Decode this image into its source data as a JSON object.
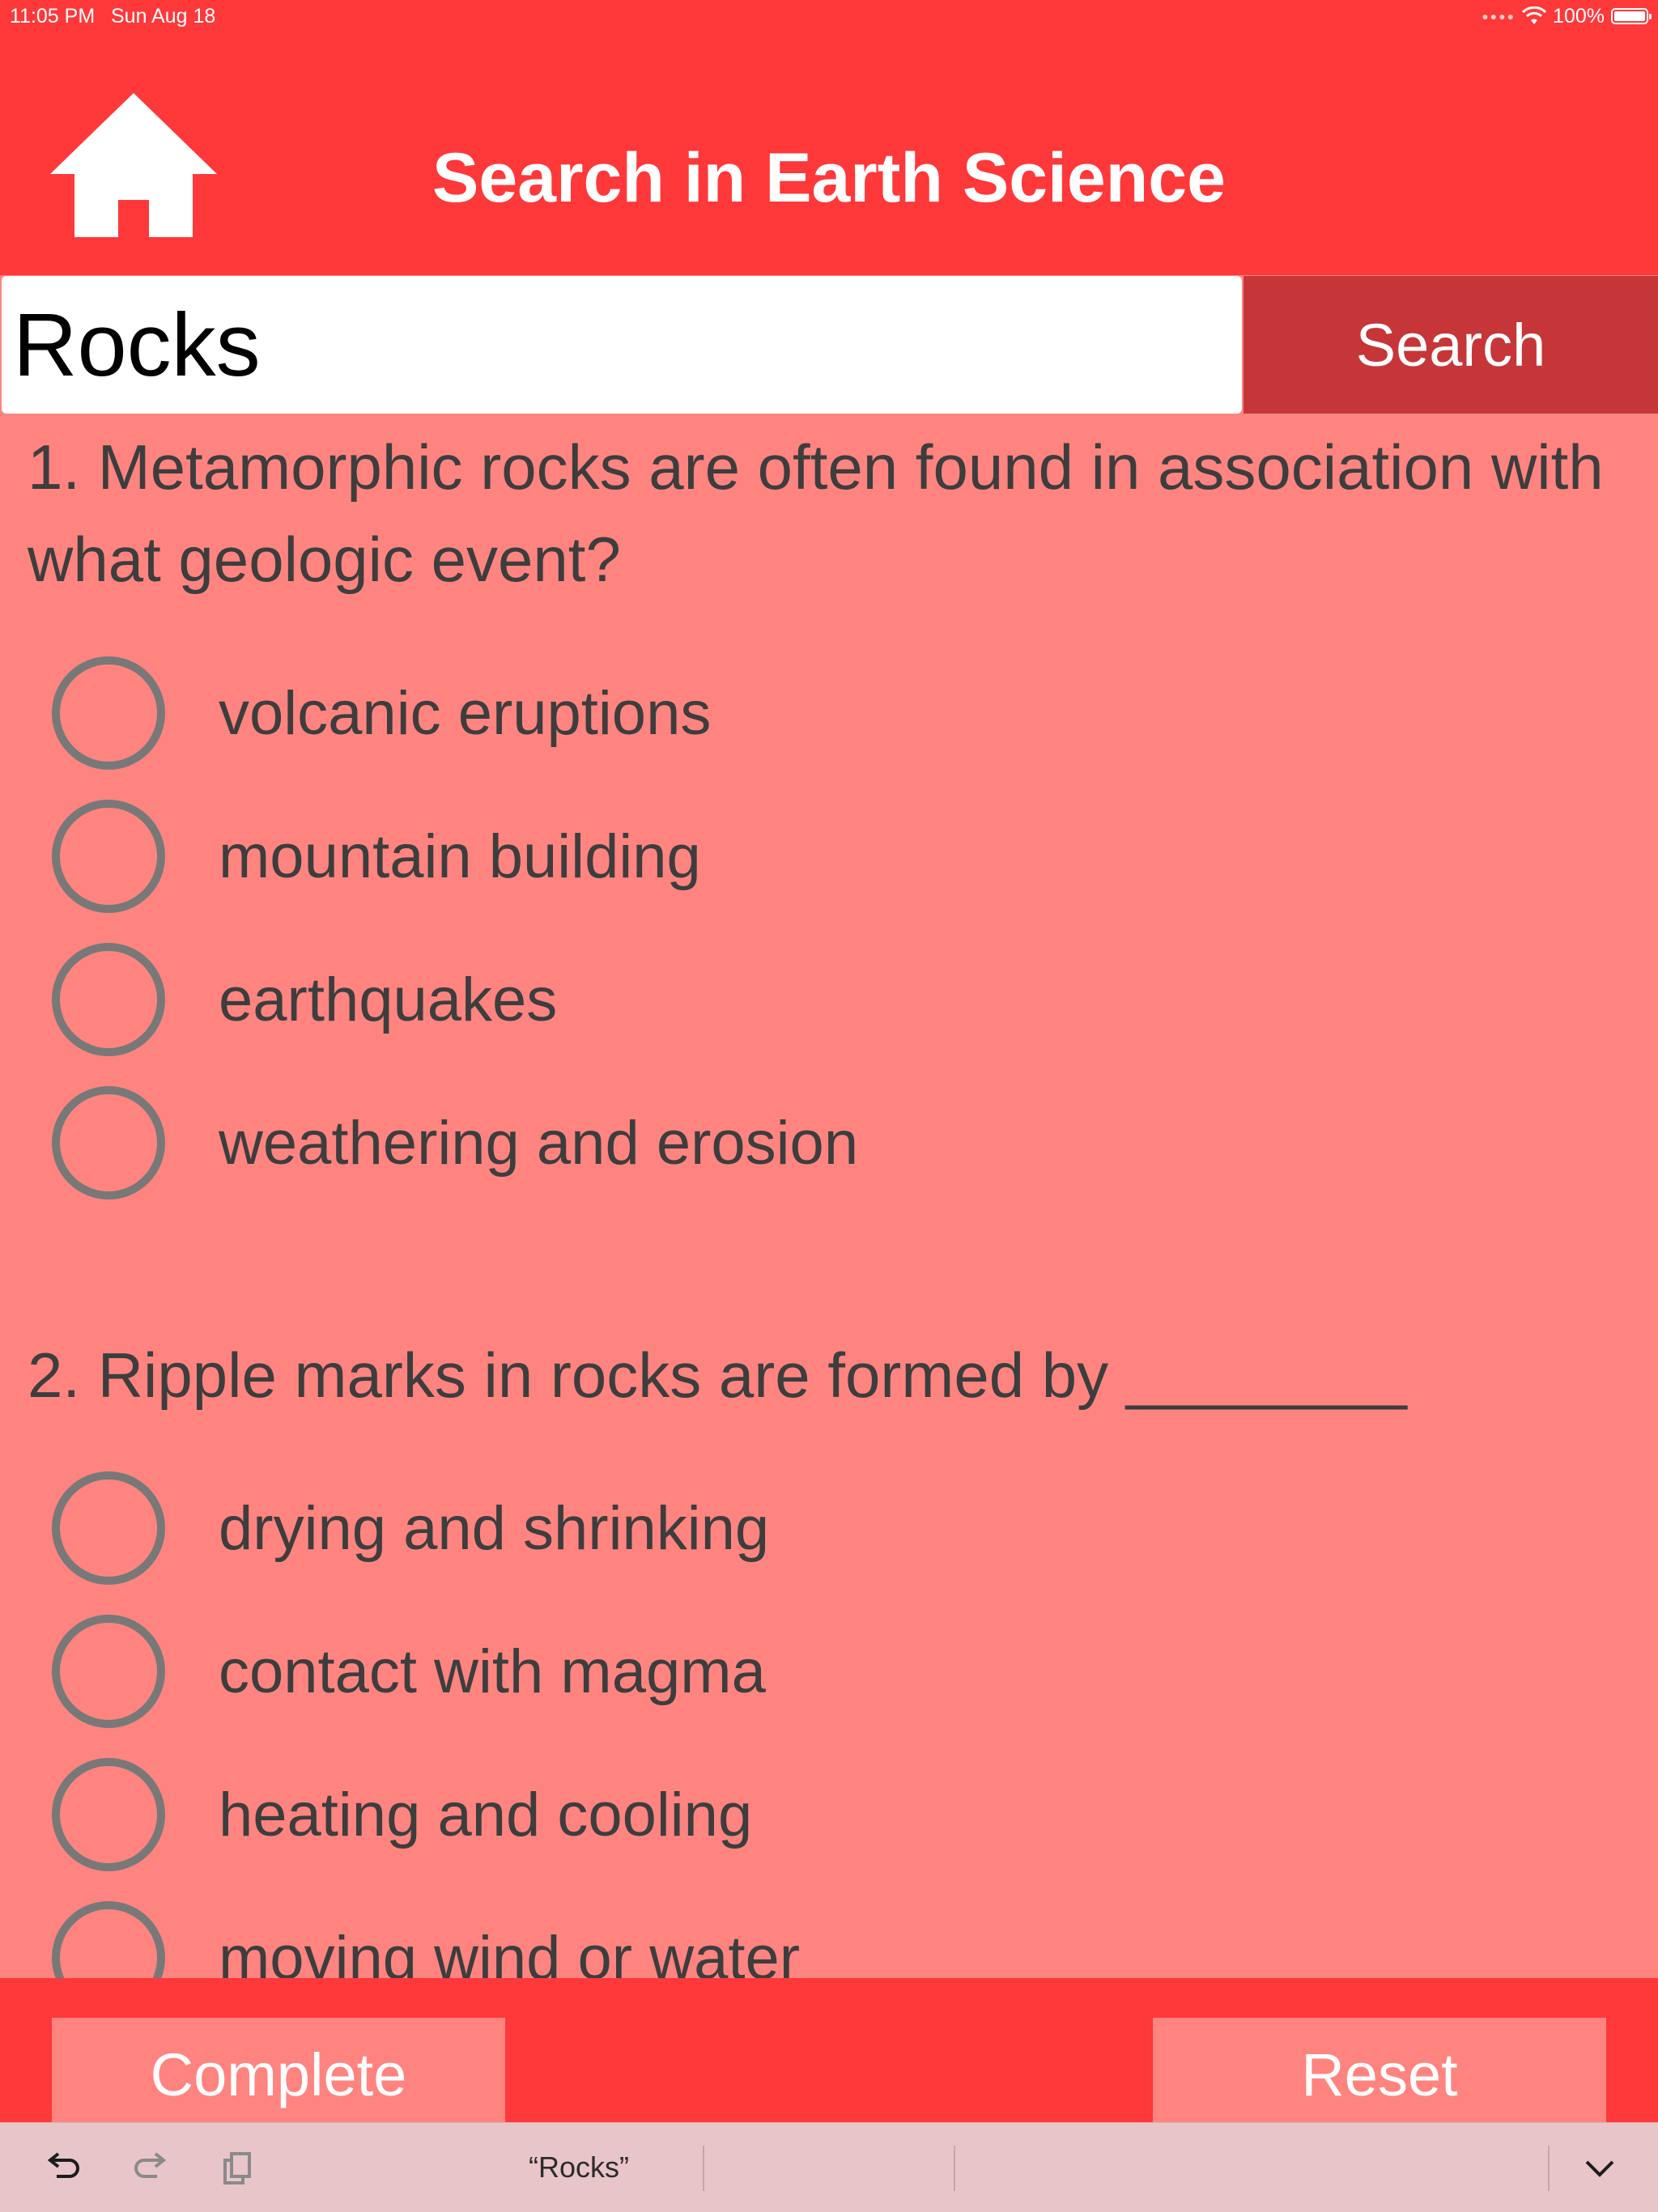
{
  "status_bar": {
    "time": "11:05 PM",
    "date": "Sun Aug 18",
    "battery": "100%"
  },
  "header": {
    "title": "Search in Earth Science",
    "home_icon": "home-icon"
  },
  "search": {
    "value": "Rocks",
    "button_label": "Search"
  },
  "questions": [
    {
      "text": "1. Metamorphic rocks are often found in association with what geologic event?",
      "options": [
        "volcanic eruptions",
        "mountain building",
        "earthquakes",
        "weathering and erosion"
      ]
    },
    {
      "text": "2. Ripple marks in rocks are formed by ________",
      "options": [
        "drying and shrinking",
        "contact with magma",
        "heating and cooling",
        "moving wind or water"
      ]
    }
  ],
  "actions": {
    "complete_label": "Complete",
    "reset_label": "Reset"
  },
  "keyboard_bar": {
    "suggestion": "“Rocks”"
  },
  "colors": {
    "header": "#ff383a",
    "background": "#ff8480",
    "search_button": "#c63638"
  }
}
